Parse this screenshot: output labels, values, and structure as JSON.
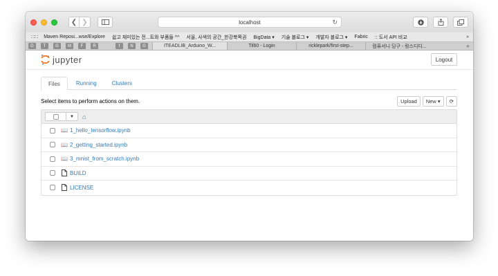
{
  "browser": {
    "address": "localhost",
    "bookmarks": [
      "Maven Reposi...wse/Explore",
      "쉽고 재미있는 전...트와 부품들 ^^",
      "서울, 사색의 공간_한강북쪽권",
      "BigData ▾",
      "기술 블로그 ▾",
      "개발자 블로그 ▾",
      "Fabric",
      ":: 도서 API 비교"
    ],
    "pinned_tabs": [
      "G",
      "T",
      "G",
      "M",
      "F",
      "R",
      "f",
      "N",
      "G"
    ],
    "tabs": [
      "ITEADLIB_Arduino_W...",
      "Til60 - Login",
      "ricklepark/first-step...",
      "컴퓨서니 딩구 - 링스디디..."
    ],
    "more_label": "»",
    "new_tab_label": "+"
  },
  "header": {
    "logo_text": "jupyter",
    "logout_label": "Logout"
  },
  "tabs": [
    {
      "label": "Files"
    },
    {
      "label": "Running"
    },
    {
      "label": "Clusters"
    }
  ],
  "actions": {
    "select_text": "Select items to perform actions on them.",
    "upload_label": "Upload",
    "new_label": "New ▾",
    "refresh_label": "⟳"
  },
  "files": [
    {
      "name": "1_hello_tensorflow.ipynb",
      "type": "notebook"
    },
    {
      "name": "2_getting_started.ipynb",
      "type": "notebook"
    },
    {
      "name": "3_mnist_from_scratch.ipynb",
      "type": "notebook"
    },
    {
      "name": "BUILD",
      "type": "file"
    },
    {
      "name": "LICENSE",
      "type": "file"
    }
  ],
  "colors": {
    "link": "#337ab7",
    "jupyter_orange": "#f37726"
  }
}
